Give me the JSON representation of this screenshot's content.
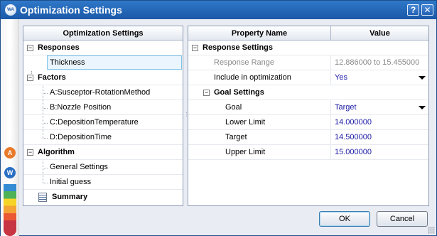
{
  "window": {
    "title": "Optimization Settings",
    "app_icon_text": "WA",
    "help_label": "?",
    "close_label": "✕"
  },
  "left_strip": {
    "icon_a_label": "A",
    "icon_w_label": "W"
  },
  "tree": {
    "header": "Optimization Settings",
    "expander_symbol": "−",
    "responses": {
      "label": "Responses",
      "items": [
        "Thickness"
      ]
    },
    "factors": {
      "label": "Factors",
      "items": [
        "A:Susceptor-RotationMethod",
        "B:Nozzle Position",
        "C:DepositionTemperature",
        "D:DepositionTime"
      ]
    },
    "algorithm": {
      "label": "Algorithm",
      "items": [
        "General Settings",
        "Initial guess"
      ]
    },
    "summary": {
      "label": "Summary"
    }
  },
  "grid": {
    "property_header": "Property Name",
    "value_header": "Value",
    "response_settings_label": "Response Settings",
    "rows": {
      "response_range": {
        "name": "Response Range",
        "value": "12.886000 to 15.455000"
      },
      "include": {
        "name": "Include in optimization",
        "value": "Yes"
      }
    },
    "goal_settings_label": "Goal Settings",
    "goal_rows": {
      "goal": {
        "name": "Goal",
        "value": "Target"
      },
      "lower_limit": {
        "name": "Lower Limit",
        "value": "14.000000"
      },
      "target": {
        "name": "Target",
        "value": "14.500000"
      },
      "upper_limit": {
        "name": "Upper Limit",
        "value": "15.000000"
      }
    }
  },
  "buttons": {
    "ok": "OK",
    "cancel": "Cancel"
  },
  "colors": {
    "title_bar": "#1b58a8",
    "selection_border": "#7fc4ea",
    "value_text": "#1a1aa6",
    "readonly_text": "#8a8a8a"
  }
}
